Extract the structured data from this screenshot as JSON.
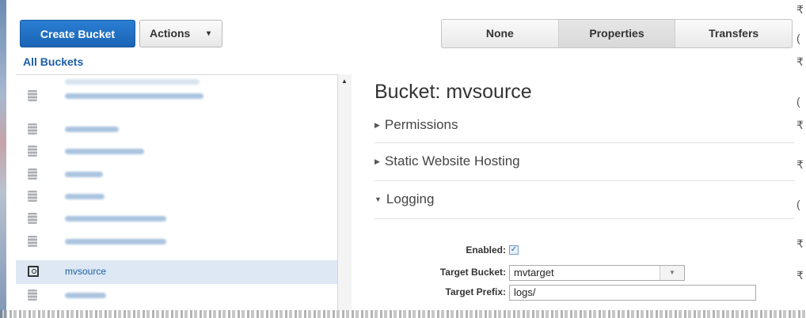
{
  "toolbar": {
    "create_bucket": "Create Bucket",
    "actions": "Actions",
    "actions_caret": "▾",
    "view_tabs": [
      "None",
      "Properties",
      "Transfers"
    ],
    "active_tab": "Properties"
  },
  "all_buckets_label": "All Buckets",
  "bucket_list": {
    "selected_name": "mvsource"
  },
  "details": {
    "title": "Bucket: mvsource",
    "sections": {
      "permissions": "Permissions",
      "static_website_hosting": "Static Website Hosting",
      "logging": "Logging"
    },
    "logging": {
      "enabled_label": "Enabled:",
      "enabled_checked": true,
      "target_bucket_label": "Target Bucket:",
      "target_bucket_value": "mvtarget",
      "target_prefix_label": "Target Prefix:",
      "target_prefix_value": "logs/"
    }
  },
  "icons": {
    "bucket": "bucket-icon",
    "selected_bucket": "magnifier-bucket-icon",
    "collapsed": "triangle-right-icon",
    "expanded": "triangle-down-icon"
  },
  "colors": {
    "primary_button": "#1b64b5",
    "link": "#1c5fa6",
    "selected_row": "#dde8f4"
  }
}
